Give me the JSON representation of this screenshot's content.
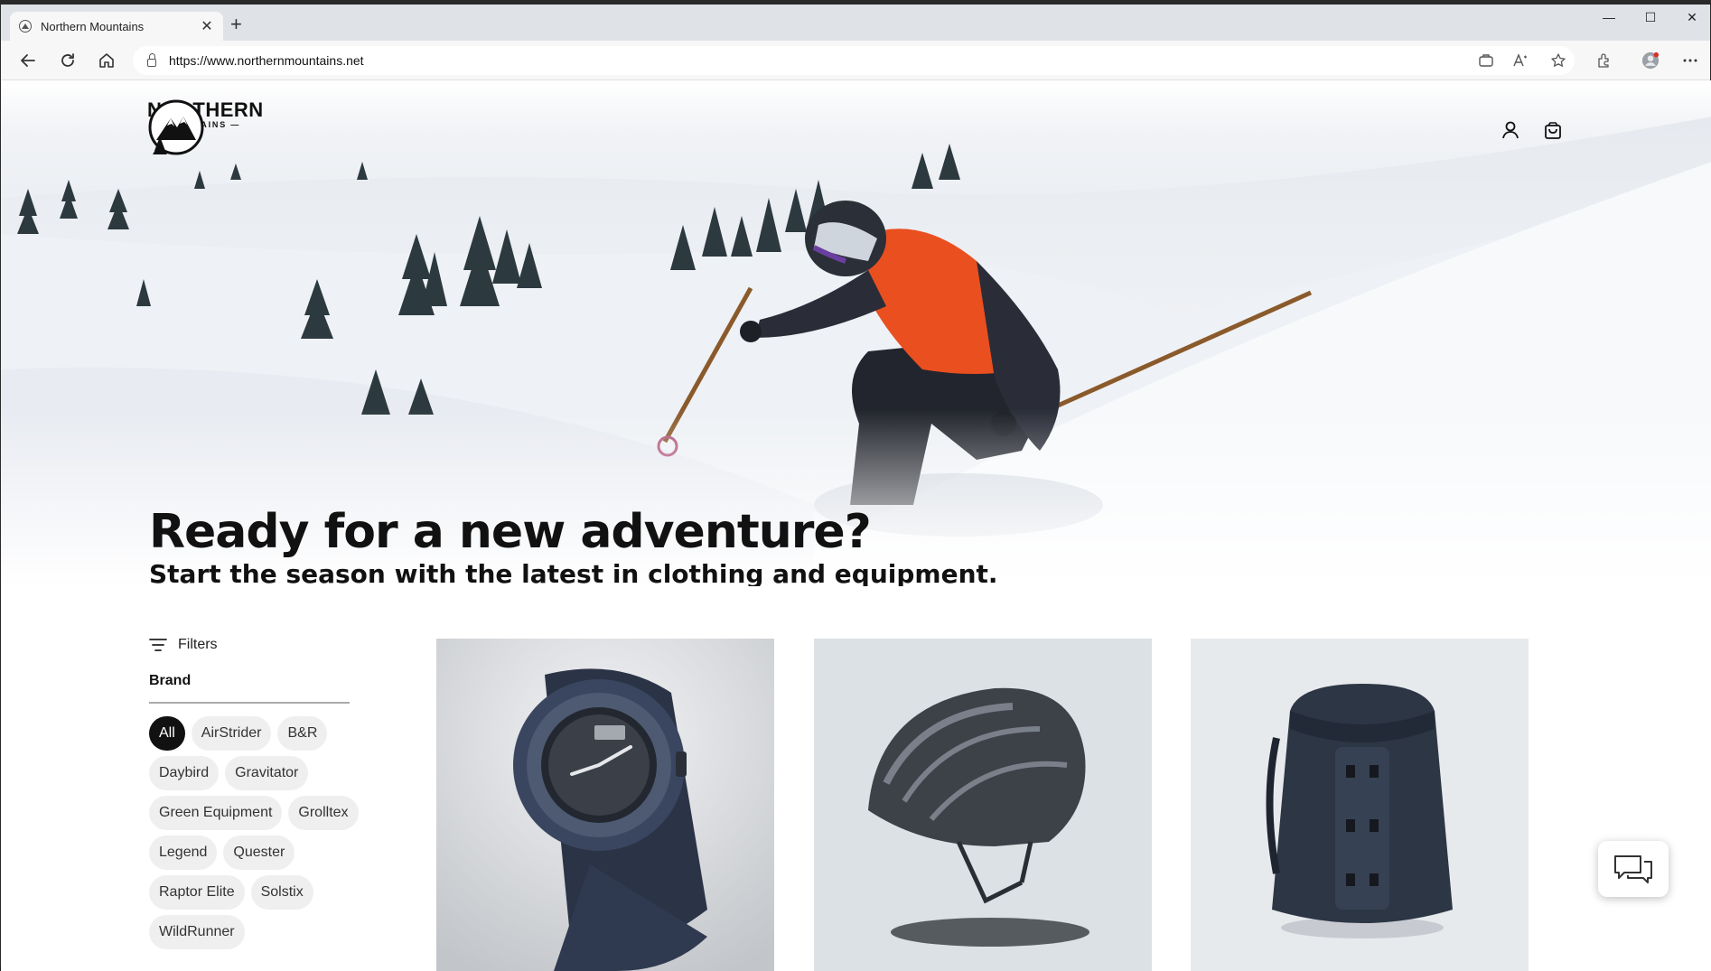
{
  "browser": {
    "tab_title": "Northern Mountains",
    "tab_close": "✕",
    "new_tab": "+",
    "url": "https://www.northernmountains.net",
    "controls": {
      "minimize": "—",
      "maximize": "☐",
      "close": "✕"
    }
  },
  "site": {
    "logo_line1": "NORTHERN",
    "logo_line2": "— MOUNTAINS —"
  },
  "hero": {
    "headline": "Ready for a new adventure?",
    "subheadline": "Start the season with the latest in clothing and equipment."
  },
  "filters": {
    "title": "Filters",
    "brand_label": "Brand",
    "brands": [
      "All",
      "AirStrider",
      "B&R",
      "Daybird",
      "Gravitator",
      "Green Equipment",
      "Grolltex",
      "Legend",
      "Quester",
      "Raptor Elite",
      "Solstix",
      "WildRunner"
    ],
    "selected": "All"
  },
  "products": [
    {
      "name": "smartwatch",
      "bg": "#cfd1d4"
    },
    {
      "name": "helmet",
      "bg": "#dde2e6"
    },
    {
      "name": "backpack",
      "bg": "#e8ebee"
    }
  ]
}
